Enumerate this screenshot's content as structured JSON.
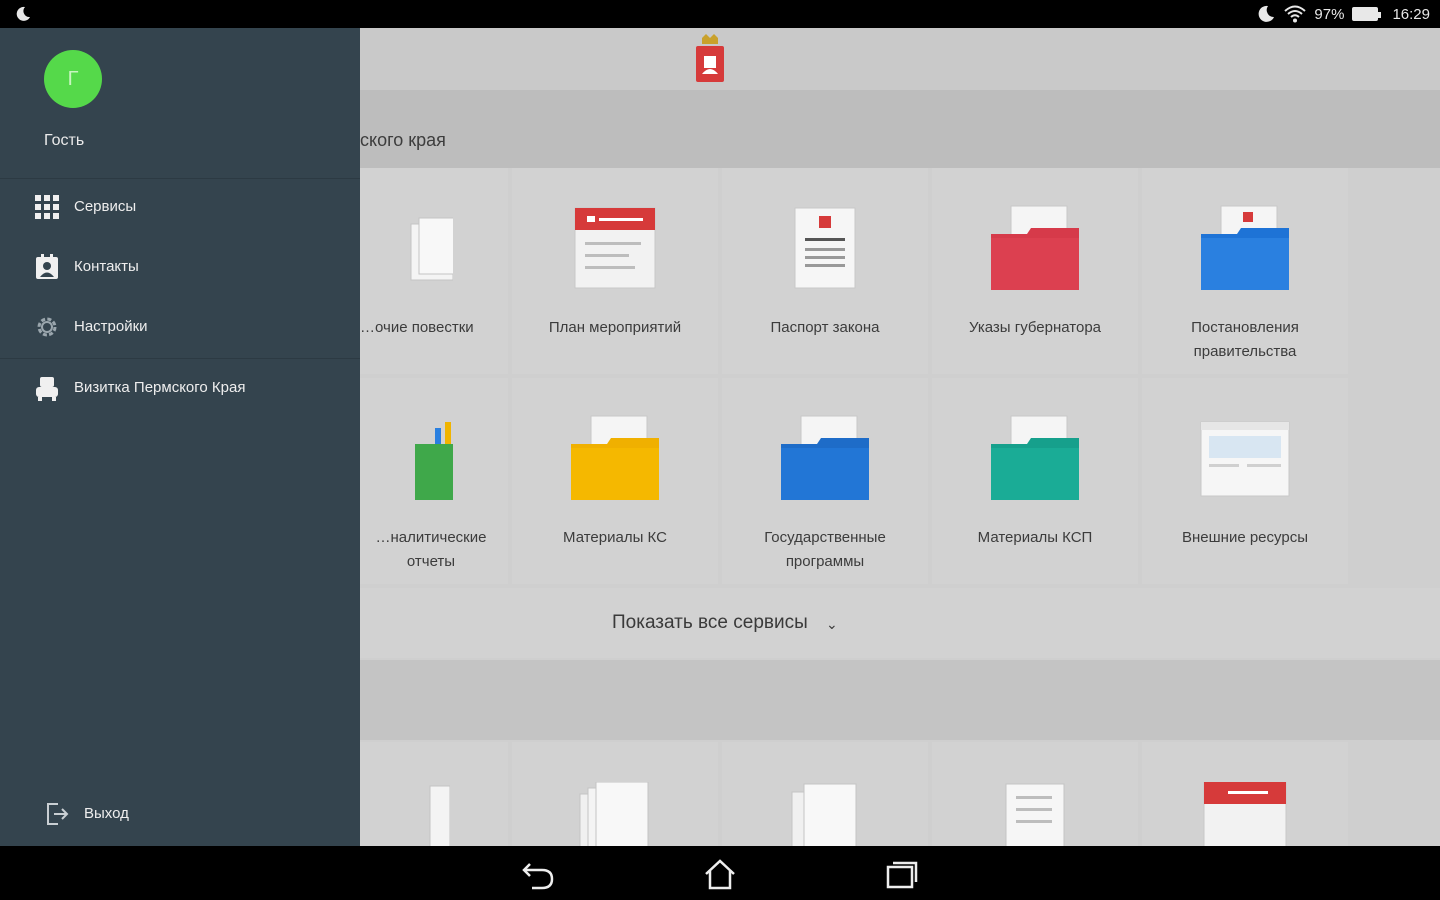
{
  "status_bar": {
    "battery": "97%",
    "time": "16:29"
  },
  "header": {
    "region_title_partial": "ского края"
  },
  "services": [
    {
      "label": "…очие повестки",
      "icon": "document-stack-icon"
    },
    {
      "label": "План мероприятий",
      "icon": "calendar-icon"
    },
    {
      "label": "Паспорт закона",
      "icon": "law-document-icon"
    },
    {
      "label": "Указы губернатора",
      "icon": "red-folder-icon"
    },
    {
      "label": "Постановления правительства",
      "icon": "blue-folder-icon"
    },
    {
      "label": "…налитические отчеты",
      "icon": "green-folder-chart-icon"
    },
    {
      "label": "Материалы КС",
      "icon": "yellow-folder-icon"
    },
    {
      "label": "Государственные программы",
      "icon": "blue-folder-check-icon"
    },
    {
      "label": "Материалы КСП",
      "icon": "teal-folder-icon"
    },
    {
      "label": "Внешние ресурсы",
      "icon": "browser-window-icon"
    }
  ],
  "show_all": {
    "label": "Показать все сервисы"
  },
  "drawer": {
    "avatar_letter": "Г",
    "user_name": "Гость",
    "items": [
      {
        "label": "Сервисы",
        "icon": "grid-icon"
      },
      {
        "label": "Контакты",
        "icon": "contacts-icon"
      },
      {
        "label": "Настройки",
        "icon": "gear-icon"
      },
      {
        "label": "Визитка Пермского Края",
        "icon": "bear-emblem-icon"
      }
    ],
    "logout_label": "Выход"
  },
  "colors": {
    "drawer_bg": "#34444e",
    "avatar": "#55d94a",
    "accent_red": "#d63a3a"
  }
}
